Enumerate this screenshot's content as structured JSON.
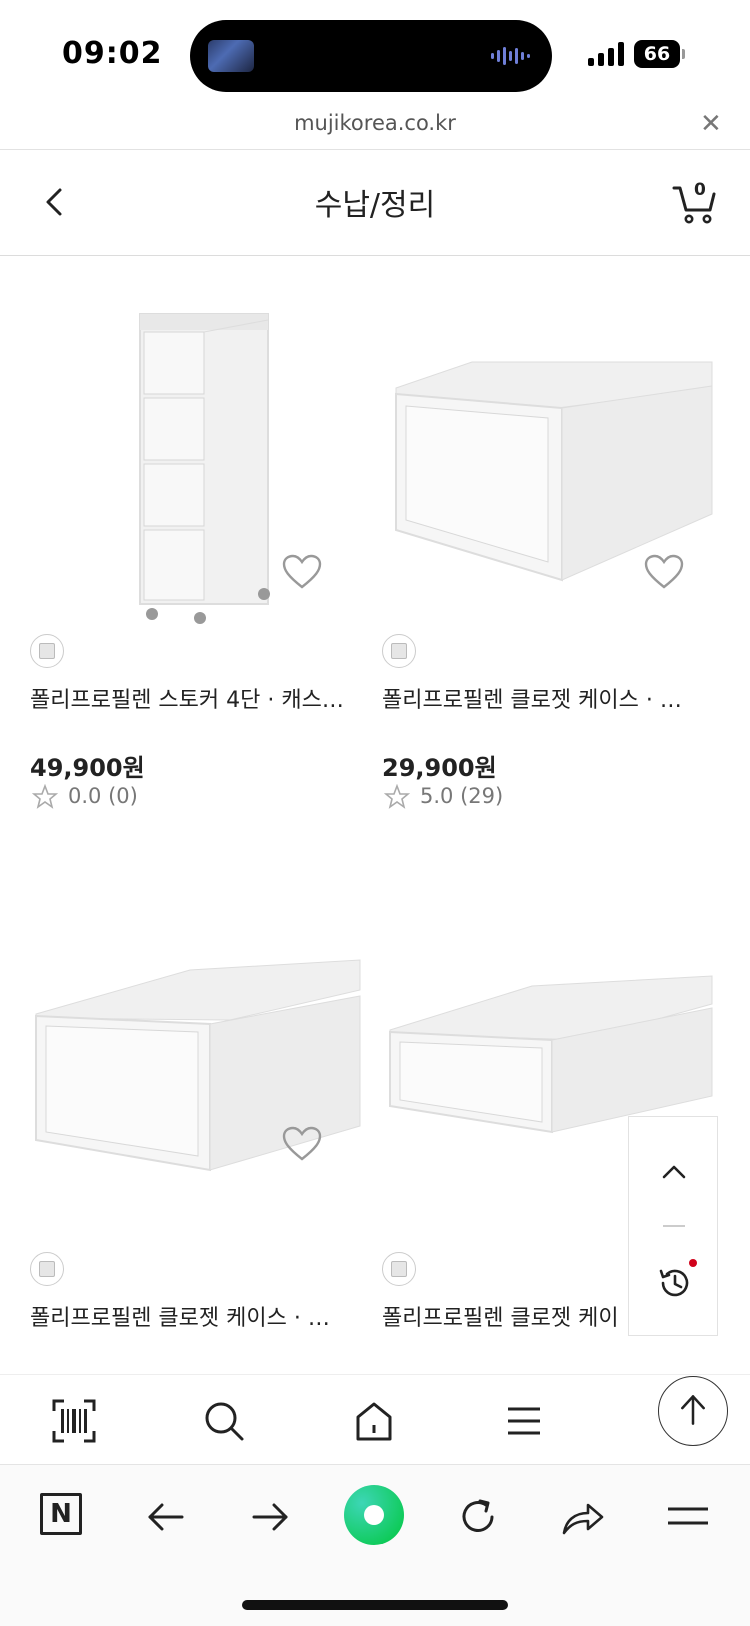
{
  "status_bar": {
    "time": "09:02",
    "battery": "66"
  },
  "browser": {
    "url": "mujikorea.co.kr"
  },
  "header": {
    "title": "수납/정리",
    "cart_count": "0"
  },
  "products": [
    {
      "name": "폴리프로필렌 스토커 4단 · 캐스…",
      "price": "49,900원",
      "rating": "0.0 (0)",
      "image": "4-tier-stocker-with-casters"
    },
    {
      "name": "폴리프로필렌 클로젯 케이스 · …",
      "price": "29,900원",
      "rating": "5.0 (29)",
      "image": "closet-case-drawer"
    },
    {
      "name": "폴리프로필렌 클로젯 케이스 · …",
      "price": "",
      "rating": "",
      "image": "closet-case-wide"
    },
    {
      "name": "폴리프로필렌 클로젯 케이",
      "price": "",
      "rating": "",
      "image": "closet-case-shallow"
    }
  ],
  "icons": {
    "nav": [
      "barcode-icon",
      "search-icon",
      "home-icon",
      "menu-icon"
    ],
    "browser": [
      "naver-icon",
      "back-arrow-icon",
      "forward-arrow-icon",
      "green-dot-icon",
      "reload-icon",
      "share-icon",
      "hamburger-icon"
    ]
  }
}
